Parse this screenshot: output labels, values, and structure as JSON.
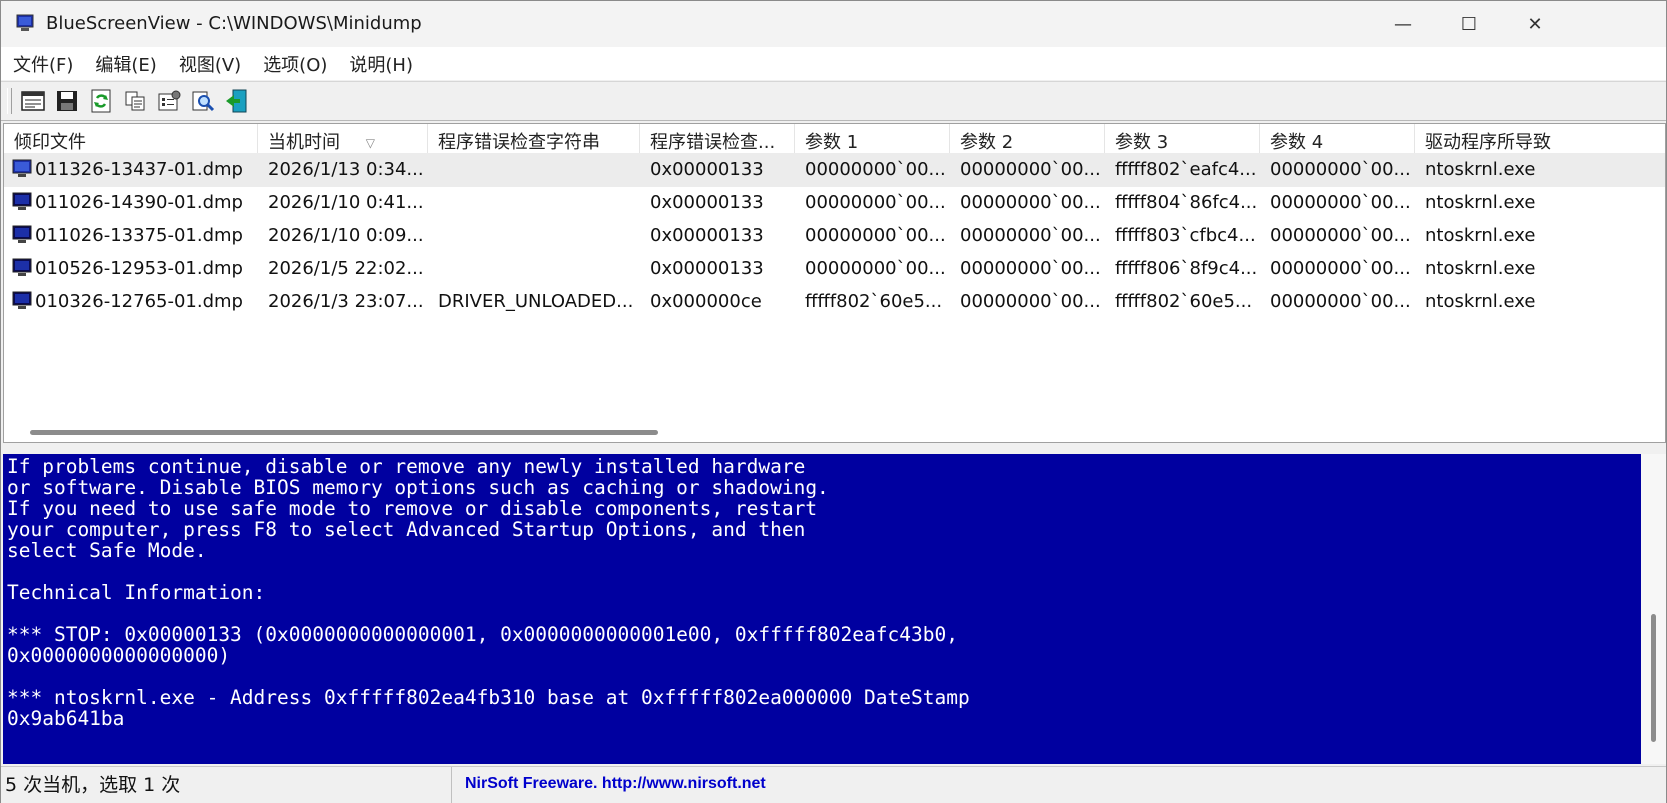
{
  "window": {
    "title": "BlueScreenView  -  C:\\WINDOWS\\Minidump",
    "minimize": "—",
    "maximize": "☐",
    "close": "✕"
  },
  "menu": [
    "文件(F)",
    "编辑(E)",
    "视图(V)",
    "选项(O)",
    "说明(H)"
  ],
  "toolbar": [
    "html-report-icon",
    "save-icon",
    "refresh-icon",
    "copy-icon",
    "properties-icon",
    "find-icon",
    "exit-icon"
  ],
  "table": {
    "columns": [
      "倾印文件",
      "当机时间",
      "程序错误检查字符串",
      "程序错误检查...",
      "参数 1",
      "参数 2",
      "参数 3",
      "参数 4",
      "驱动程序所导致"
    ],
    "sort_indicator": "▽",
    "rows": [
      [
        "011326-13437-01.dmp",
        "2026/1/13 0:34...",
        "",
        "0x00000133",
        "00000000`00...",
        "00000000`00...",
        "fffff802`eafc4...",
        "00000000`00...",
        "ntoskrnl.exe"
      ],
      [
        "011026-14390-01.dmp",
        "2026/1/10 0:41...",
        "",
        "0x00000133",
        "00000000`00...",
        "00000000`00...",
        "fffff804`86fc4...",
        "00000000`00...",
        "ntoskrnl.exe"
      ],
      [
        "011026-13375-01.dmp",
        "2026/1/10 0:09...",
        "",
        "0x00000133",
        "00000000`00...",
        "00000000`00...",
        "fffff803`cfbc4...",
        "00000000`00...",
        "ntoskrnl.exe"
      ],
      [
        "010526-12953-01.dmp",
        "2026/1/5 22:02...",
        "",
        "0x00000133",
        "00000000`00...",
        "00000000`00...",
        "fffff806`8f9c4...",
        "00000000`00...",
        "ntoskrnl.exe"
      ],
      [
        "010326-12765-01.dmp",
        "2026/1/3 23:07...",
        "DRIVER_UNLOADED...",
        "0x000000ce",
        "fffff802`60e5...",
        "00000000`00...",
        "fffff802`60e5...",
        "00000000`00...",
        "ntoskrnl.exe"
      ]
    ]
  },
  "bsod_lines": [
    "If problems continue, disable or remove any newly installed hardware",
    "or software. Disable BIOS memory options such as caching or shadowing.",
    "If you need to use safe mode to remove or disable components, restart",
    "your computer, press F8 to select Advanced Startup Options, and then",
    "select Safe Mode.",
    "",
    "Technical Information:",
    "",
    "*** STOP: 0x00000133 (0x0000000000000001, 0x0000000000001e00, 0xfffff802eafc43b0,",
    "0x0000000000000000)",
    "",
    "*** ntoskrnl.exe - Address 0xfffff802ea4fb310 base at 0xfffff802ea000000 DateStamp",
    "0x9ab641ba"
  ],
  "status": {
    "count": "5 次当机，选取 1 次",
    "credit": "NirSoft Freeware.  http://www.nirsoft.net"
  },
  "colors": {
    "bsod_bg": "#0000a0",
    "link": "#0000cc",
    "selected_row": "#ececec"
  }
}
